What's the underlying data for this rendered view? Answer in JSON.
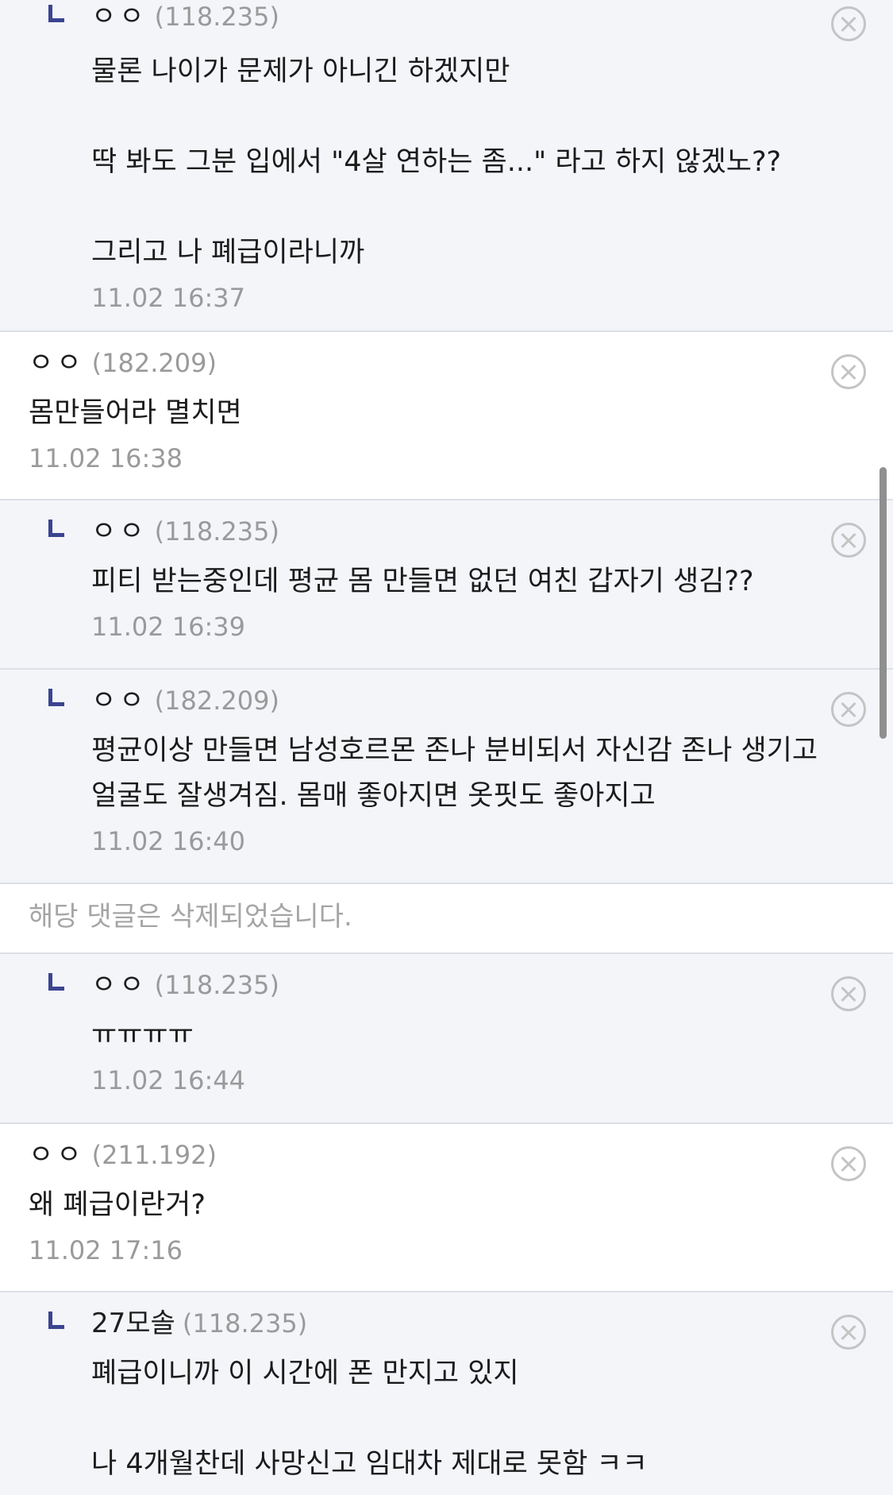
{
  "comments": [
    {
      "type": "reply",
      "nickname": "ㅇㅇ",
      "ip": "(118.235)",
      "text": "물론 나이가 문제가 아니긴 하겠지만\n\n딱 봐도 그분 입에서 \"4살 연하는 좀...\" 라고 하지 않겠노??\n\n그리고 나 폐급이라니까",
      "date": "11.02 16:37"
    },
    {
      "type": "top",
      "nickname": "ㅇㅇ",
      "ip": "(182.209)",
      "text": "몸만들어라 멸치면",
      "date": "11.02 16:38"
    },
    {
      "type": "reply",
      "nickname": "ㅇㅇ",
      "ip": "(118.235)",
      "text": "피티 받는중인데 평균 몸 만들면 없던 여친 갑자기 생김??",
      "date": "11.02 16:39"
    },
    {
      "type": "reply",
      "nickname": "ㅇㅇ",
      "ip": "(182.209)",
      "text": "평균이상 만들면 남성호르몬 존나 분비되서 자신감 존나 생기고\n얼굴도 잘생겨짐. 몸매 좋아지면 옷핏도 좋아지고",
      "date": "11.02 16:40"
    },
    {
      "type": "deleted",
      "text": "해당 댓글은 삭제되었습니다."
    },
    {
      "type": "reply",
      "nickname": "ㅇㅇ",
      "ip": "(118.235)",
      "text": "ㅠㅠㅠㅠ",
      "date": "11.02 16:44"
    },
    {
      "type": "top",
      "nickname": "ㅇㅇ",
      "ip": "(211.192)",
      "text": "왜 폐급이란거?",
      "date": "11.02 17:16"
    },
    {
      "type": "reply",
      "nickname": "27모솔",
      "ip": "(118.235)",
      "text": "폐급이니까 이 시간에 폰 만지고 있지\n\n나 4개월찬데 사망신고 임대차 제대로 못함 ㅋㅋ",
      "date": ""
    }
  ],
  "icons": {
    "delete": "close-circle-icon",
    "reply": "reply-arrow-icon"
  },
  "colors": {
    "reply_background": "#f3f5f9",
    "reply_arrow": "#3b4490",
    "meta_gray": "#9a9a9a"
  }
}
